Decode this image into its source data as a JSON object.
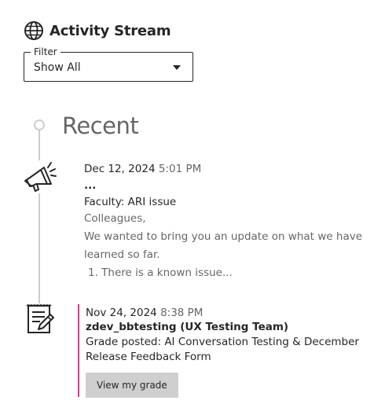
{
  "header": {
    "title": "Activity Stream",
    "icon": "globe-icon"
  },
  "filter": {
    "legend": "Filter",
    "selected": "Show All"
  },
  "section": {
    "title": "Recent"
  },
  "items": [
    {
      "icon": "megaphone-icon",
      "date": "Dec 12, 2024",
      "time": "5:01 PM",
      "sender": "...",
      "subject": "Faculty: ARI issue",
      "body_lines": [
        "Colleagues,",
        "We wanted to bring you an update on what we have",
        "learned so far.",
        "1. There is a known issue..."
      ]
    },
    {
      "icon": "grade-document-icon",
      "accent_color": "#d63b8a",
      "date": "Nov 24, 2024",
      "time": "8:38 PM",
      "author": "zdev_bbtesting (UX Testing Team)",
      "description": "Grade posted: AI Conversation Testing & December Release Feedback Form",
      "button_label": "View my grade"
    }
  ]
}
